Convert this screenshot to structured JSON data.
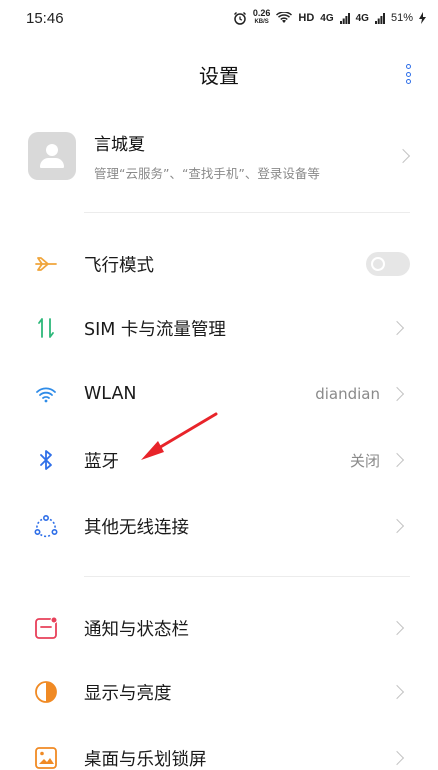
{
  "status_bar": {
    "time": "15:46",
    "net_speed_value": "0.26",
    "net_speed_unit": "KB/S",
    "hd_label": "HD",
    "signal1": "4G",
    "signal2": "4G",
    "battery": "51%"
  },
  "header": {
    "title": "设置"
  },
  "account": {
    "name": "言城夏",
    "description": "管理“云服务”、“查找手机”、登录设备等"
  },
  "settings": {
    "airplane": {
      "label": "飞行模式",
      "toggle_on": false
    },
    "sim": {
      "label": "SIM 卡与流量管理"
    },
    "wlan": {
      "label": "WLAN",
      "value": "diandian"
    },
    "bluetooth": {
      "label": "蓝牙",
      "value": "关闭"
    },
    "wireless": {
      "label": "其他无线连接"
    },
    "notification": {
      "label": "通知与状态栏"
    },
    "display": {
      "label": "显示与亮度"
    },
    "desktop": {
      "label": "桌面与乐划锁屏"
    }
  },
  "colors": {
    "airplane_icon": "#f0a53b",
    "sim_icon": "#2db87a",
    "wlan_icon": "#2f8ce8",
    "bluetooth_icon": "#2f6fe8",
    "wireless_icon": "#2f6fe8",
    "notification_icon": "#e8405a",
    "display_icon": "#f08a24",
    "desktop_icon": "#f08a24",
    "annotation_arrow": "#e8242a"
  },
  "icons": {
    "airplane": "airplane-icon",
    "sim": "sim-arrows-icon",
    "wlan": "wifi-icon",
    "bluetooth": "bluetooth-icon",
    "wireless": "wireless-connect-icon",
    "notification": "notification-icon",
    "display": "brightness-icon",
    "desktop": "desktop-icon"
  }
}
